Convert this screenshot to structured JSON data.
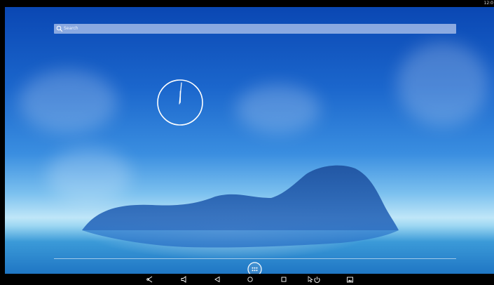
{
  "status_bar": {
    "time": "12:0"
  },
  "search": {
    "placeholder": "Search",
    "icon": "search-icon"
  },
  "widgets": {
    "clock": {
      "type": "analog",
      "icon": "analog-clock"
    }
  },
  "dock": {
    "all_apps_icon": "all-apps-icon"
  },
  "navigation_bar": {
    "buttons": [
      {
        "icon": "share-icon"
      },
      {
        "icon": "volume-down-icon"
      },
      {
        "icon": "back-icon"
      },
      {
        "icon": "home-icon"
      },
      {
        "icon": "recents-icon"
      },
      {
        "icon": "power-icon"
      },
      {
        "icon": "screenshot-icon"
      }
    ]
  },
  "colors": {
    "sky_top": "#0a47b3",
    "sky_mid": "#3a8ee0",
    "horizon": "#bfe6f8",
    "bars": "#000000",
    "icon": "#ffffff"
  }
}
